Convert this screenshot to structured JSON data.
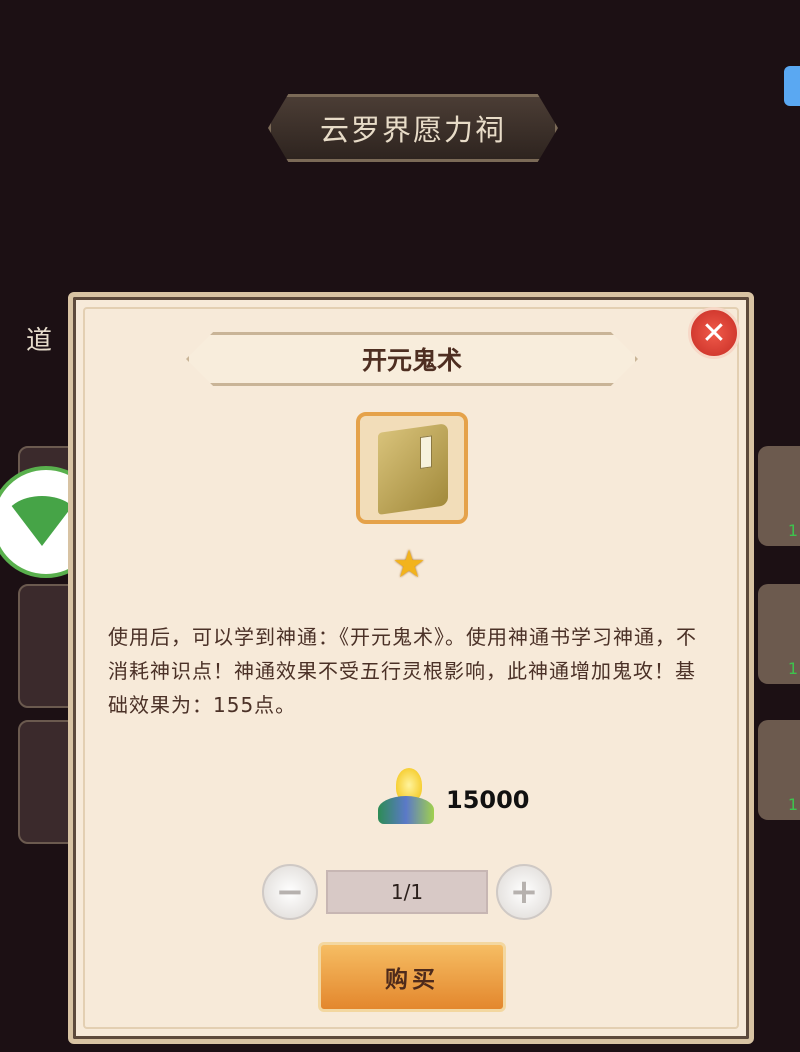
{
  "header": {
    "title": "云罗界愿力祠",
    "side_label": "道"
  },
  "dialog": {
    "item_name": "开元鬼术",
    "stars": 1,
    "description": "使用后，可以学到神通：《开元鬼术》。使用神通书学习神通，不消耗神识点！神通效果不受五行灵根影响，此神通增加鬼攻！基础效果为：155点。",
    "price": "15000",
    "quantity": "1/1",
    "buy_label": "购买",
    "minus_label": "−",
    "plus_label": "+",
    "close_label": "✕"
  },
  "background_items": [
    {
      "qty": "1"
    },
    {
      "qty": "1"
    },
    {
      "qty": "1"
    }
  ]
}
